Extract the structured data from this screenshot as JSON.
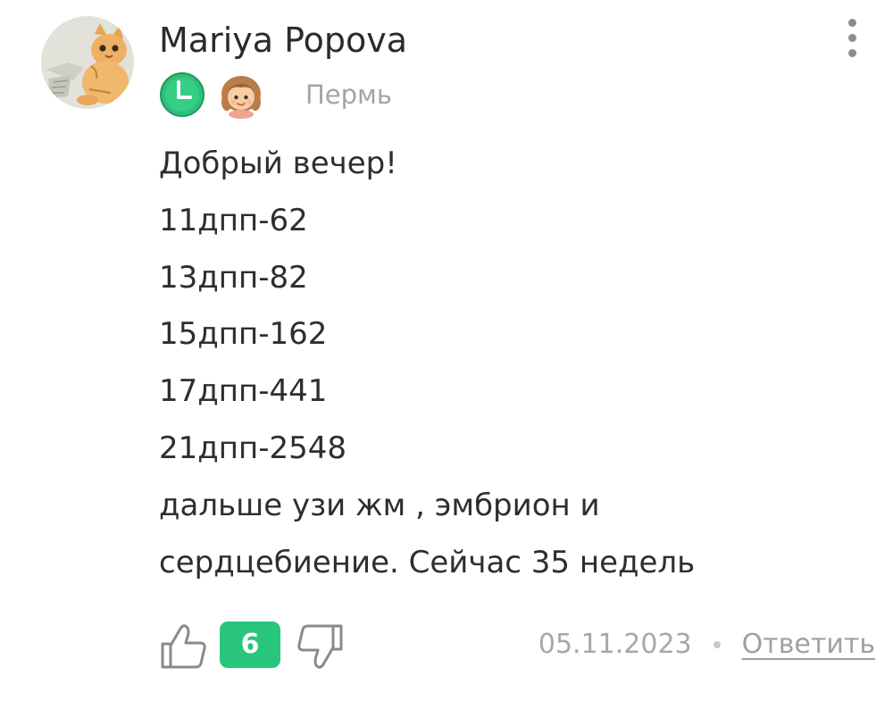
{
  "comment": {
    "author": "Mariya Popova",
    "city": "Пермь",
    "badges": [
      "clock-badge-icon",
      "girl-badge-icon"
    ],
    "body_lines": [
      "Добрый вечер!",
      "11дпп-62",
      "13дпп-82",
      "15дпп-162",
      "17дпп-441",
      "21дпп-2548",
      "дальше узи жм , эмбрион и",
      "сердцебиение. Сейчас 35 недель"
    ],
    "likes": "6",
    "date": "05.11.2023",
    "reply_label": "Ответить"
  },
  "colors": {
    "accent_green": "#2ac57d",
    "text": "#2e2e2e",
    "muted": "#a8a8a8"
  }
}
